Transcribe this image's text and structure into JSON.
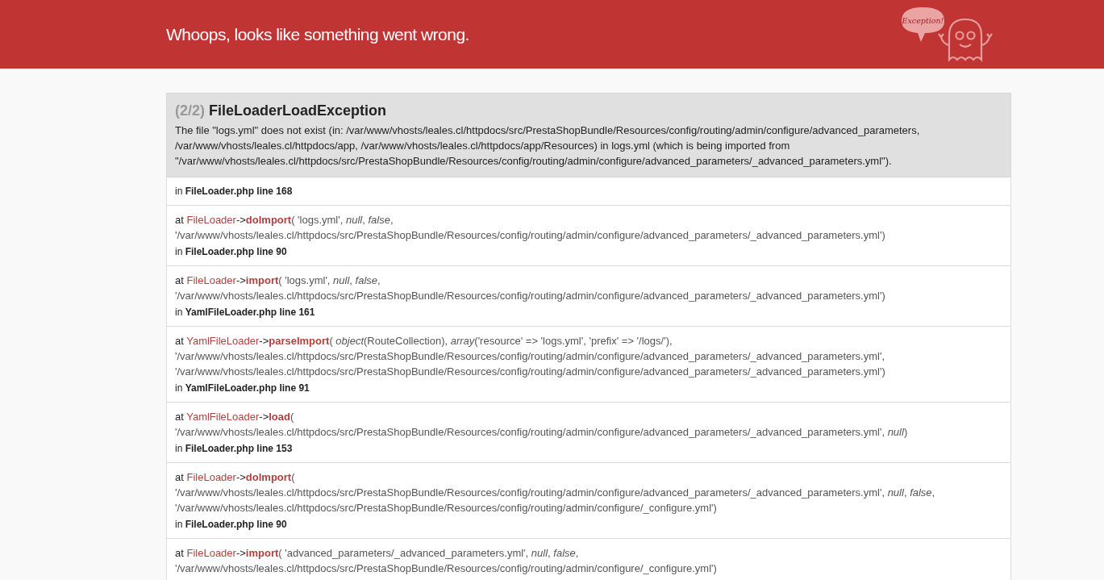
{
  "header": {
    "title": "Whoops, looks like something went wrong.",
    "mascot_bubble": "Exception!"
  },
  "exception": {
    "count": "(2/2)",
    "name": "FileLoaderLoadException",
    "message": "The file \"logs.yml\" does not exist (in: /var/www/vhosts/leales.cl/httpdocs/src/PrestaShopBundle/Resources/config/routing/admin/configure/advanced_parameters, /var/www/vhosts/leales.cl/httpdocs/app, /var/www/vhosts/leales.cl/httpdocs/app/Resources) in logs.yml (which is being imported from \"/var/www/vhosts/leales.cl/httpdocs/src/PrestaShopBundle/Resources/config/routing/admin/configure/advanced_parameters/_advanced_parameters.yml\")."
  },
  "frames": [
    {
      "kind": "location",
      "location": "in **FileLoader.php line 168**"
    },
    {
      "kind": "call",
      "at": "at",
      "class": "FileLoader",
      "arrow": "->",
      "function": "doImport",
      "args": "( 'logs.yml', *null*, *false*, '/var/www/vhosts/leales.cl/httpdocs/src/PrestaShopBundle/Resources/config/routing/admin/configure/advanced_parameters/_advanced_parameters.yml')",
      "location": "in **FileLoader.php line 90**"
    },
    {
      "kind": "call",
      "at": "at",
      "class": "FileLoader",
      "arrow": "->",
      "function": "import",
      "args": "( 'logs.yml', *null*, *false*, '/var/www/vhosts/leales.cl/httpdocs/src/PrestaShopBundle/Resources/config/routing/admin/configure/advanced_parameters/_advanced_parameters.yml')",
      "location": "in **YamlFileLoader.php line 161**"
    },
    {
      "kind": "call",
      "at": "at",
      "class": "YamlFileLoader",
      "arrow": "->",
      "function": "parseImport",
      "args": "( *object*(RouteCollection), *array*('resource' => 'logs.yml', 'prefix' => '/logs/'), '/var/www/vhosts/leales.cl/httpdocs/src/PrestaShopBundle/Resources/config/routing/admin/configure/advanced_parameters/_advanced_parameters.yml', '/var/www/vhosts/leales.cl/httpdocs/src/PrestaShopBundle/Resources/config/routing/admin/configure/advanced_parameters/_advanced_parameters.yml')",
      "location": "in **YamlFileLoader.php line 91**"
    },
    {
      "kind": "call",
      "at": "at",
      "class": "YamlFileLoader",
      "arrow": "->",
      "function": "load",
      "args": "( '/var/www/vhosts/leales.cl/httpdocs/src/PrestaShopBundle/Resources/config/routing/admin/configure/advanced_parameters/_advanced_parameters.yml', *null*)",
      "location": "in **FileLoader.php line 153**"
    },
    {
      "kind": "call",
      "at": "at",
      "class": "FileLoader",
      "arrow": "->",
      "function": "doImport",
      "args": "( '/var/www/vhosts/leales.cl/httpdocs/src/PrestaShopBundle/Resources/config/routing/admin/configure/advanced_parameters/_advanced_parameters.yml', *null*, *false*, '/var/www/vhosts/leales.cl/httpdocs/src/PrestaShopBundle/Resources/config/routing/admin/configure/_configure.yml')",
      "location": "in **FileLoader.php line 90**"
    },
    {
      "kind": "call",
      "at": "at",
      "class": "FileLoader",
      "arrow": "->",
      "function": "import",
      "args": "( 'advanced_parameters/_advanced_parameters.yml', *null*, *false*, '/var/www/vhosts/leales.cl/httpdocs/src/PrestaShopBundle/Resources/config/routing/admin/configure/_configure.yml')"
    }
  ]
}
